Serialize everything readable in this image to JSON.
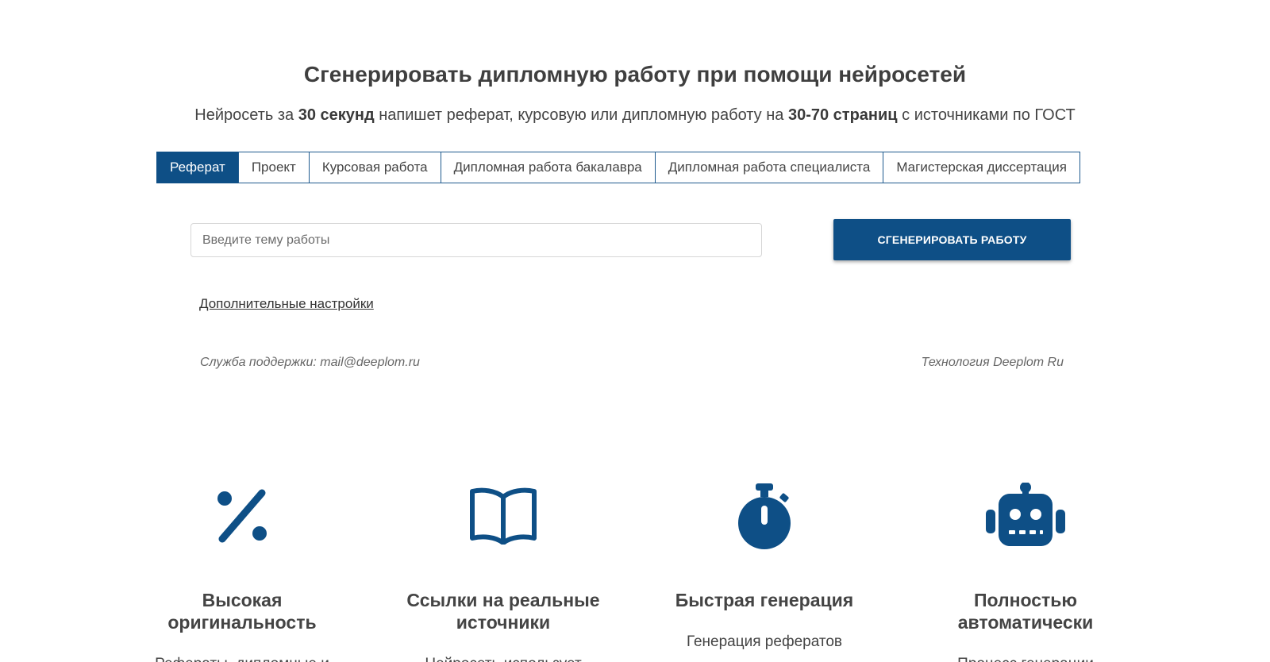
{
  "header": {
    "title": "Сгенерировать дипломную работу при помощи нейросетей",
    "subtitle": {
      "part1": "Нейросеть за ",
      "bold1": "30 секунд",
      "part2": " напишет реферат, курсовую или дипломную работу на ",
      "bold2": "30-70 страниц",
      "part3": " с источниками по ГОСТ"
    }
  },
  "tabs": [
    {
      "label": "Реферат",
      "active": true
    },
    {
      "label": "Проект",
      "active": false
    },
    {
      "label": "Курсовая работа",
      "active": false
    },
    {
      "label": "Дипломная работа бакалавра",
      "active": false
    },
    {
      "label": "Дипломная работа специалиста",
      "active": false
    },
    {
      "label": "Магистерская диссертация",
      "active": false
    }
  ],
  "form": {
    "topic_value": "",
    "topic_placeholder": "Введите тему работы",
    "generate_label": "СГЕНЕРИРОВАТЬ РАБОТУ",
    "extra_settings_label": "Дополнительные настройки"
  },
  "footer": {
    "support": "Служба поддержки: mail@deeplom.ru",
    "technology": "Технология Deeplom Ru"
  },
  "features": [
    {
      "icon": "percent-icon",
      "title_line1": "Высокая",
      "title_line2": "оригинальность",
      "desc": "Рефераты, дипломные и"
    },
    {
      "icon": "open-book-icon",
      "title_line1": "Ссылки на реальные",
      "title_line2": "источники",
      "desc": "Нейросеть использует"
    },
    {
      "icon": "stopwatch-icon",
      "title_line1": "Быстрая генерация",
      "title_line2": "",
      "desc": "Генерация рефератов"
    },
    {
      "icon": "robot-icon",
      "title_line1": "Полностью",
      "title_line2": "автоматически",
      "desc": "Процесс генерации"
    }
  ],
  "colors": {
    "brand": "#0e4f86",
    "text": "#444444",
    "muted": "#666666"
  }
}
